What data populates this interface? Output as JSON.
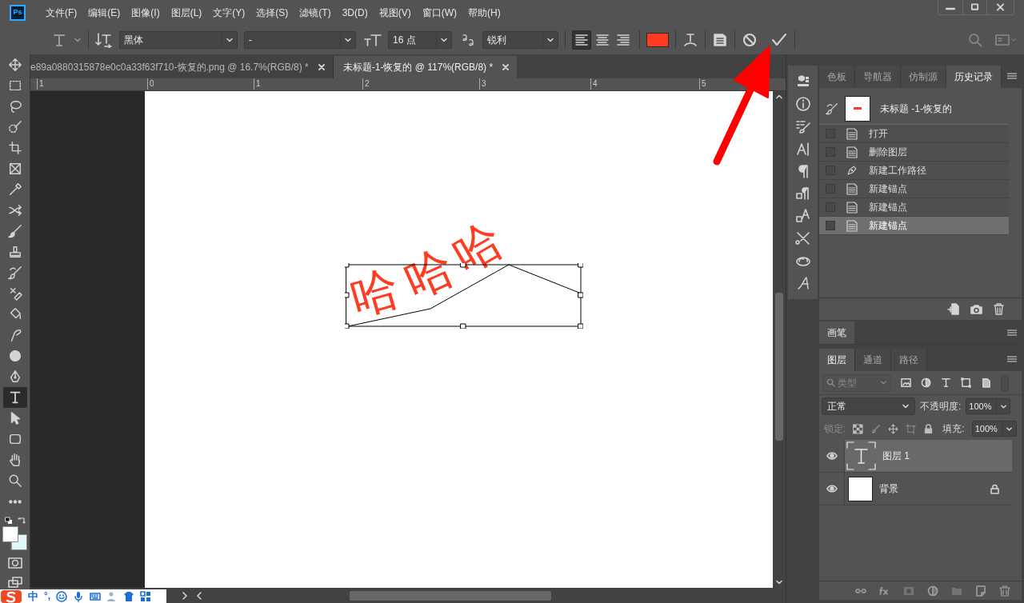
{
  "app": {
    "logo": "Ps"
  },
  "menu": [
    "文件(F)",
    "编辑(E)",
    "图像(I)",
    "图层(L)",
    "文字(Y)",
    "选择(S)",
    "滤镜(T)",
    "3D(D)",
    "视图(V)",
    "窗口(W)",
    "帮助(H)"
  ],
  "options": {
    "font_family": "黑体",
    "font_style": "-",
    "font_size": "16 点",
    "antialias": "锐利",
    "align": [
      {
        "selected": true
      },
      {
        "selected": false
      },
      {
        "selected": false
      }
    ]
  },
  "document_tabs": [
    {
      "title": "e89a0880315878e0c0a33f63f710-恢复的.png @ 16.7%(RGB/8) *",
      "selected": false
    },
    {
      "title": "未标题-1-恢复的 @ 117%(RGB/8) *",
      "selected": true
    }
  ],
  "ruler": [
    "1",
    "0",
    "1",
    "2",
    "3",
    "4",
    "5"
  ],
  "canvas": {
    "text": "哈哈哈"
  },
  "tools": [
    {
      "selected": false
    },
    {
      "selected": false
    },
    {
      "selected": false
    },
    {
      "selected": false
    },
    {
      "selected": false
    },
    {
      "selected": false
    },
    {
      "selected": false
    },
    {
      "selected": false
    },
    {
      "selected": false
    },
    {
      "selected": false
    },
    {
      "selected": false
    },
    {
      "selected": false
    },
    {
      "selected": false
    },
    {
      "selected": false
    },
    {
      "selected": false
    },
    {
      "selected": false
    },
    {
      "selected": true
    },
    {
      "selected": false
    },
    {
      "selected": false
    },
    {
      "selected": false
    },
    {
      "selected": false
    },
    {
      "selected": false
    }
  ],
  "history": {
    "tabs": [
      {
        "label": "色板",
        "selected": false
      },
      {
        "label": "导航器",
        "selected": false
      },
      {
        "label": "仿制源",
        "selected": false
      },
      {
        "label": "历史记录",
        "selected": true
      }
    ],
    "snapshot": "未标题 -1-恢复的",
    "items": [
      {
        "kind": "doc",
        "label": "打开",
        "selected": false
      },
      {
        "kind": "doc",
        "label": "删除图层",
        "selected": false
      },
      {
        "kind": "pen",
        "label": "新建工作路径",
        "selected": false
      },
      {
        "kind": "doc",
        "label": "新建锚点",
        "selected": false
      },
      {
        "kind": "doc",
        "label": "新建锚点",
        "selected": false
      },
      {
        "kind": "doc",
        "label": "新建锚点",
        "selected": true
      }
    ]
  },
  "brush_panel": {
    "tab": "画笔"
  },
  "layers": {
    "tabs": [
      {
        "label": "图层",
        "selected": true
      },
      {
        "label": "通道",
        "selected": false
      },
      {
        "label": "路径",
        "selected": false
      }
    ],
    "filter_placeholder": "类型",
    "blend_mode": "正常",
    "opacity_label": "不透明度:",
    "opacity": "100%",
    "lock_label": "锁定:",
    "fill_label": "填充:",
    "fill": "100%",
    "items": [
      {
        "kind": "text",
        "name": "图层 1",
        "visible": true,
        "locked": false,
        "selected": true
      },
      {
        "kind": "image",
        "name": "背景",
        "visible": true,
        "locked": true,
        "selected": false
      }
    ]
  },
  "ime": {
    "mode": "中",
    "punctuation": "°,"
  }
}
